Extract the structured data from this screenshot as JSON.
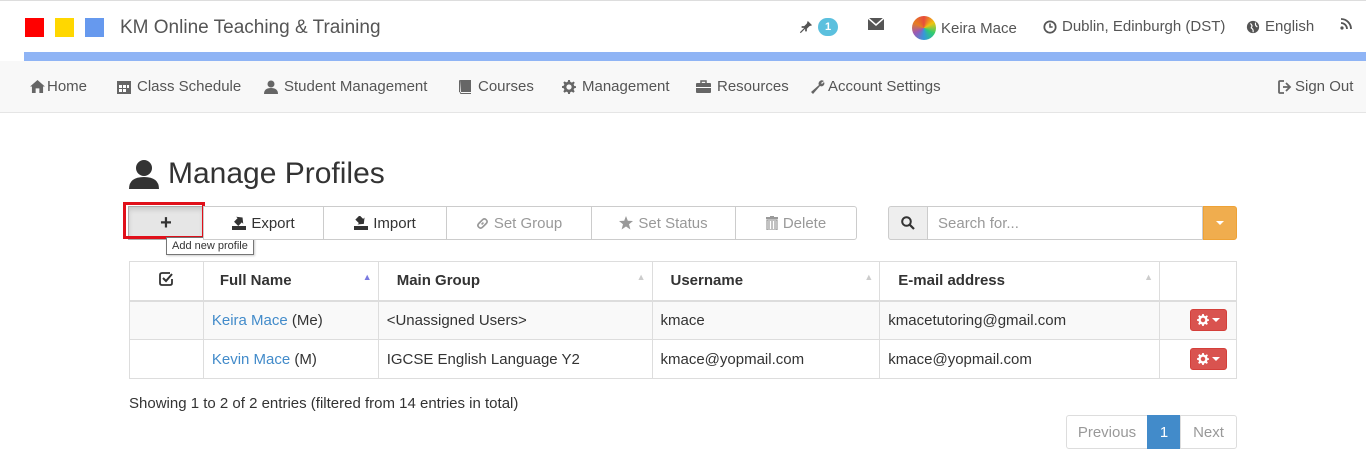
{
  "header": {
    "app_title": "KM Online Teaching & Training",
    "logo_colors": [
      "#ff0000",
      "#ffd700",
      "#6699ee"
    ],
    "pin_count": "1",
    "user_name": "Keira Mace",
    "timezone": "Dublin, Edinburgh (DST)",
    "language": "English"
  },
  "nav": {
    "items": [
      {
        "label": "Home",
        "icon": "home-icon"
      },
      {
        "label": "Class Schedule",
        "icon": "calendar-icon"
      },
      {
        "label": "Student Management",
        "icon": "user-icon"
      },
      {
        "label": "Courses",
        "icon": "book-icon"
      },
      {
        "label": "Management",
        "icon": "gear-icon"
      },
      {
        "label": "Resources",
        "icon": "briefcase-icon"
      },
      {
        "label": "Account Settings",
        "icon": "wrench-icon"
      }
    ],
    "sign_out": "Sign Out"
  },
  "page": {
    "title": "Manage Profiles"
  },
  "toolbar": {
    "add_symbol": "+",
    "add_tooltip": "Add new profile",
    "export": "Export",
    "import": "Import",
    "set_group": "Set Group",
    "set_status": "Set Status",
    "delete": "Delete"
  },
  "search": {
    "placeholder": "Search for..."
  },
  "table": {
    "columns": [
      "Full Name",
      "Main Group",
      "Username",
      "E-mail address"
    ],
    "rows": [
      {
        "name": "Keira Mace",
        "suffix": "(Me)",
        "group": "<Unassigned Users>",
        "username": "kmace",
        "email": "kmacetutoring@gmail.com"
      },
      {
        "name": "Kevin Mace",
        "suffix": "(M)",
        "group": "IGCSE English Language Y2",
        "username": "kmace@yopmail.com",
        "email": "kmace@yopmail.com"
      }
    ]
  },
  "info": "Showing 1 to 2 of 2 entries (filtered from 14 entries in total)",
  "pagination": {
    "previous": "Previous",
    "current": "1",
    "next": "Next"
  },
  "colors": {
    "accent_blue": "#428bca",
    "danger": "#d9534f",
    "warning": "#f0ad4e",
    "strip": "#8fb4f5"
  }
}
